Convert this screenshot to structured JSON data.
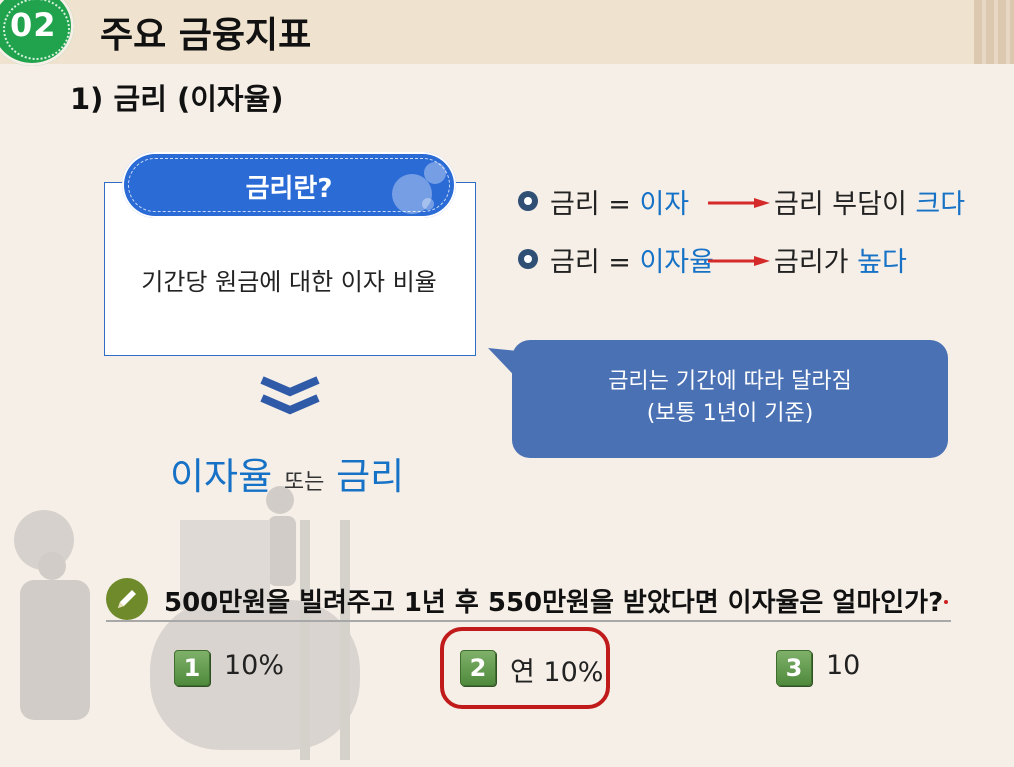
{
  "header": {
    "section_number": "02",
    "section_title": "주요 금융지표"
  },
  "subheading": "1) 금리 (이자율)",
  "definition": {
    "pill_label": "금리란?",
    "text": "기간당 원금에 대한 이자 비율"
  },
  "result": {
    "term1": "이자율",
    "connector": "또는",
    "term2": "금리"
  },
  "bullets": [
    {
      "prefix": "금리 = ",
      "highlight": "이자",
      "result_prefix": "금리 부담이 ",
      "result_highlight": "크다"
    },
    {
      "prefix": "금리 = ",
      "highlight": "이자율",
      "result_prefix": "금리가 ",
      "result_highlight": "높다"
    }
  ],
  "callout": {
    "line1": "금리는 기간에 따라 달라짐",
    "line2": "(보통 1년이 기준)"
  },
  "question": {
    "text": "500만원을 빌려주고 1년 후 550만원을 받았다면 이자율은 얼마인가?",
    "options": [
      {
        "number": "1",
        "text": "10%"
      },
      {
        "number": "2",
        "text": "연 10%"
      },
      {
        "number": "3",
        "text": "10"
      }
    ],
    "highlighted_option": "2"
  },
  "colors": {
    "accent_blue": "#1672c6",
    "pill_blue": "#2b6bd6",
    "callout_blue": "#4a71b4",
    "badge_green": "#21a34e",
    "highlight_red": "#c01a1a",
    "arrow_red": "#d42a2a"
  },
  "icons": [
    "pencil-icon",
    "chevron-down-icon",
    "arrow-right-icon",
    "bullet-icon"
  ]
}
